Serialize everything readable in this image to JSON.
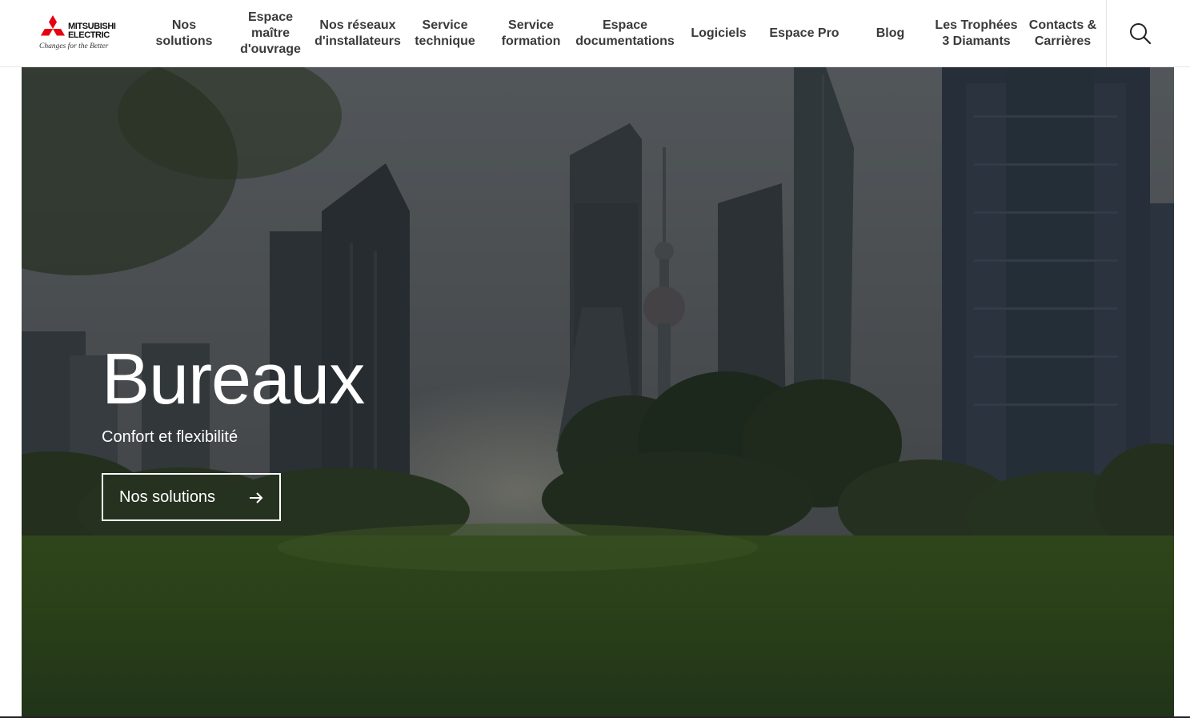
{
  "brand": {
    "name_line1": "MITSUBISHI",
    "name_line2": "ELECTRIC",
    "tagline": "Changes for the Better",
    "logo_color": "#e60012"
  },
  "nav": {
    "items": [
      {
        "label": "Nos\nsolutions"
      },
      {
        "label": "Espace\nmaître\nd'ouvrage"
      },
      {
        "label": "Nos réseaux\nd'installateurs"
      },
      {
        "label": "Service\ntechnique"
      },
      {
        "label": "Service\nformation"
      },
      {
        "label": "Espace\ndocumentations"
      },
      {
        "label": "Logiciels"
      },
      {
        "label": "Espace Pro"
      },
      {
        "label": "Blog"
      },
      {
        "label": "Les Trophées\n3 Diamants"
      },
      {
        "label": "Contacts &\nCarrières"
      }
    ],
    "search_icon": "search-icon"
  },
  "hero": {
    "title": "Bureaux",
    "subtitle": "Confort et flexibilité",
    "cta_label": "Nos solutions",
    "cta_icon": "arrow-right-icon"
  }
}
